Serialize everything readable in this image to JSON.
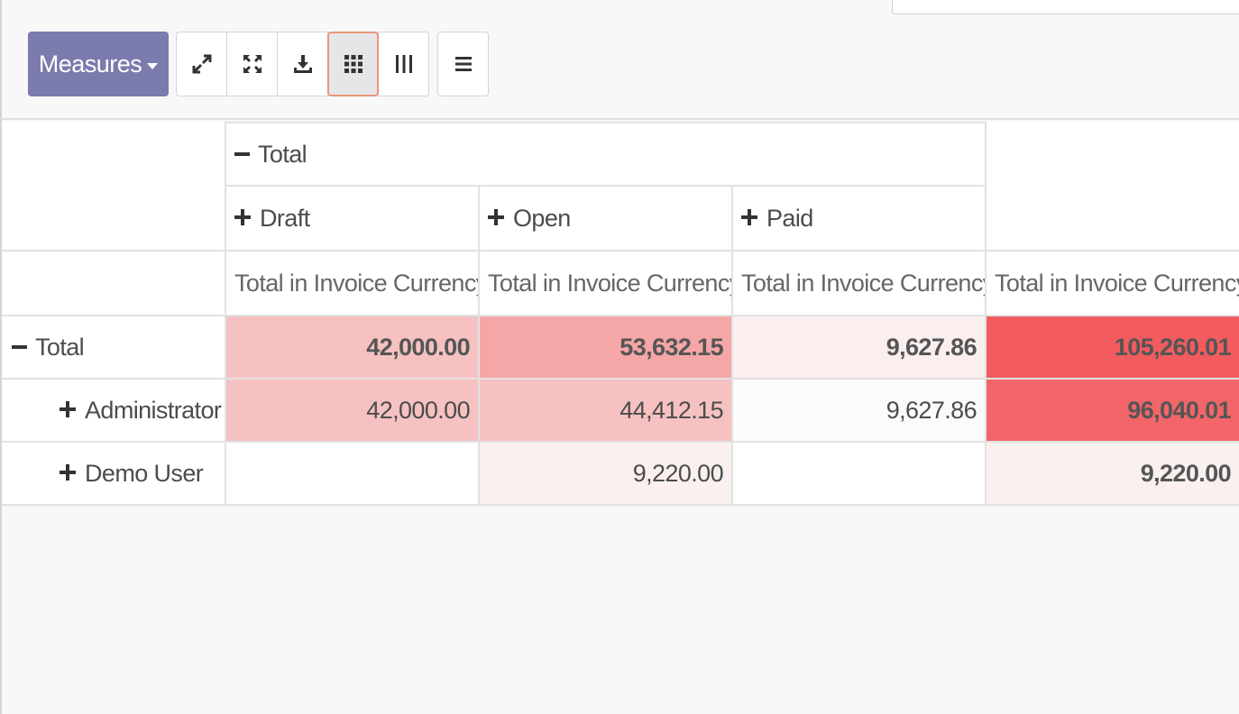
{
  "toolbar": {
    "measures_label": "Measures",
    "icons": [
      "expand-icon",
      "collapse-all-icon",
      "download-icon",
      "grid-view-icon",
      "columns-view-icon",
      "list-view-icon"
    ],
    "active_icon": "grid-view-icon",
    "accent_color": "#7c7bad"
  },
  "pivot": {
    "col_group_label": "Total",
    "col_groups": [
      "Draft",
      "Open",
      "Paid"
    ],
    "measure_label": "Total in Invoice Currency",
    "rows": [
      {
        "label": "Total",
        "expanded": true,
        "values": [
          "42,000.00",
          "53,632.15",
          "9,627.86"
        ],
        "total": "105,260.01"
      },
      {
        "label": "Administrator",
        "expanded": false,
        "values": [
          "42,000.00",
          "44,412.15",
          "9,627.86"
        ],
        "total": "96,040.01"
      },
      {
        "label": "Demo User",
        "expanded": false,
        "values": [
          "",
          "9,220.00",
          ""
        ],
        "total": "9,220.00"
      }
    ],
    "heat_colors": {
      "r0c0": "#f6c1c1",
      "r0c1": "#f5a6a6",
      "r0c2": "#fbeeee",
      "r0c3": "#f25c5f",
      "r1c0": "#f6c1c1",
      "r1c1": "#f6c1c1",
      "r1c2": "#fafbfa",
      "r1c3": "#f26669",
      "r2c0": "#ffffff",
      "r2c1": "#fbf0f0",
      "r2c2": "#ffffff",
      "r2c3": "#fbf0f0"
    }
  }
}
